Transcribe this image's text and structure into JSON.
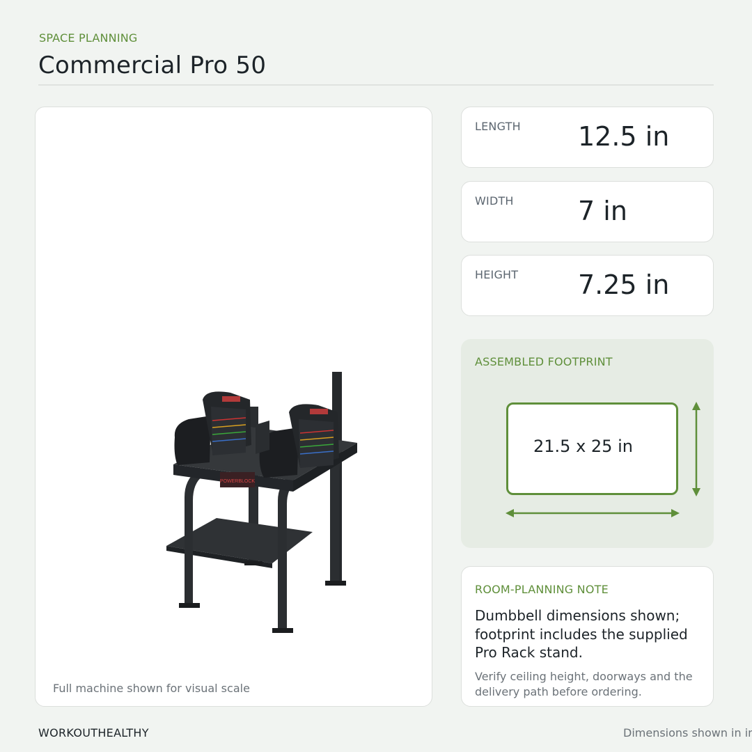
{
  "header": {
    "eyebrow": "SPACE PLANNING",
    "title": "Commercial Pro 50"
  },
  "image_panel": {
    "caption": "Full machine shown for visual scale",
    "image_label": "POWERBLOCK"
  },
  "dimensions": [
    {
      "label": "LENGTH",
      "value": "12.5 in"
    },
    {
      "label": "WIDTH",
      "value": "7 in"
    },
    {
      "label": "HEIGHT",
      "value": "7.25 in"
    }
  ],
  "footprint": {
    "label": "ASSEMBLED FOOTPRINT",
    "value": "21.5 x 25 in"
  },
  "note": {
    "label": "ROOM-PLANNING NOTE",
    "body": "Dumbbell dimensions shown; footprint includes the supplied Pro Rack stand.",
    "sub": "Verify ceiling height, doorways and the delivery path before ordering."
  },
  "footer": {
    "brand": "WORKOUTHEALTHY",
    "note": "Dimensions shown in inches"
  },
  "colors": {
    "accent": "#5f8f3a",
    "background": "#f1f4f1",
    "footprint_panel": "#e6ece4"
  }
}
